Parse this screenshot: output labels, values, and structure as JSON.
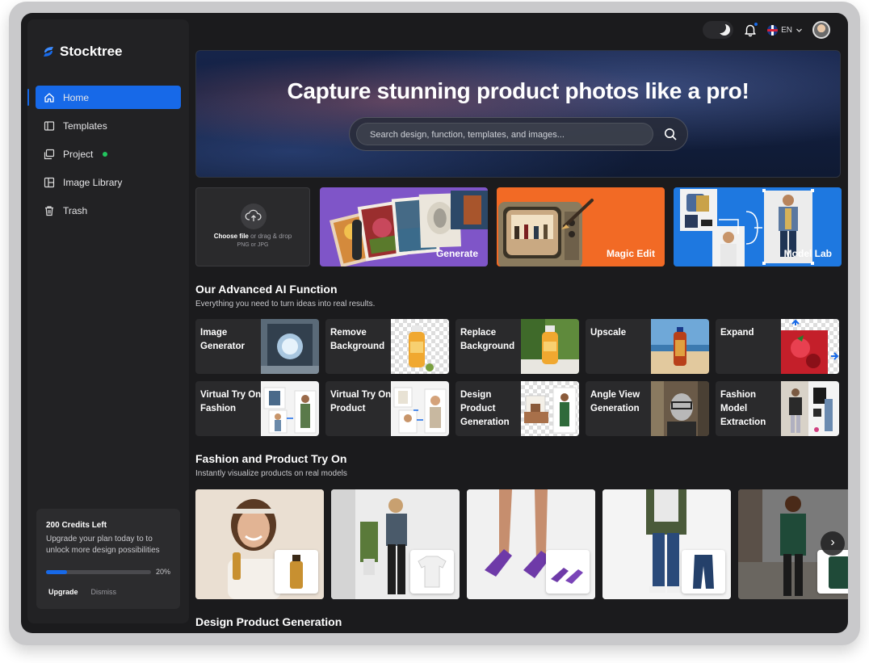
{
  "app": {
    "name": "Stocktree"
  },
  "sidebar": {
    "items": [
      {
        "label": "Home",
        "icon": "home-icon",
        "active": true
      },
      {
        "label": "Templates",
        "icon": "templates-icon"
      },
      {
        "label": "Project",
        "icon": "project-icon",
        "status_dot": true
      },
      {
        "label": "Image Library",
        "icon": "image-library-icon"
      },
      {
        "label": "Trash",
        "icon": "trash-icon"
      }
    ],
    "credits": {
      "title": "200 Credits Left",
      "description": "Upgrade your plan today to to unlock more design possibilities",
      "progress_percent": 20,
      "progress_label": "20%",
      "upgrade_label": "Upgrade",
      "dismiss_label": "Dismiss"
    }
  },
  "topbar": {
    "language": "EN"
  },
  "hero": {
    "title": "Capture stunning product photos like a pro!",
    "search_placeholder": "Search design, function, templates, and images..."
  },
  "upload": {
    "choose_label": "Choose file",
    "drag_label": "or drag & drop",
    "formats": "PNG or JPG"
  },
  "feature_cards": [
    {
      "label": "Generate",
      "color": "#7f55c8"
    },
    {
      "label": "Magic Edit",
      "color": "#f26a25"
    },
    {
      "label": "Model Lab",
      "color": "#1e78e0"
    }
  ],
  "ai_functions": {
    "title": "Our Advanced AI Function",
    "subtitle": "Everything you need to turn ideas into real results.",
    "items": [
      {
        "label": "Image Generator"
      },
      {
        "label": "Remove Background"
      },
      {
        "label": "Replace Background"
      },
      {
        "label": "Upscale"
      },
      {
        "label": "Expand"
      },
      {
        "label": "Virtual Try On Fashion"
      },
      {
        "label": "Virtual Try On Product"
      },
      {
        "label": "Design Product Generation"
      },
      {
        "label": "Angle View Generation"
      },
      {
        "label": "Fashion Model Extraction"
      }
    ]
  },
  "try_on": {
    "title": "Fashion and Product Try On",
    "subtitle": "Instantly visualize products on real models"
  },
  "next_section": {
    "title": "Design Product Generation"
  },
  "colors": {
    "accent": "#1769e8",
    "background": "#1b1b1d",
    "panel": "#2a2a2c",
    "online": "#22c55e"
  }
}
